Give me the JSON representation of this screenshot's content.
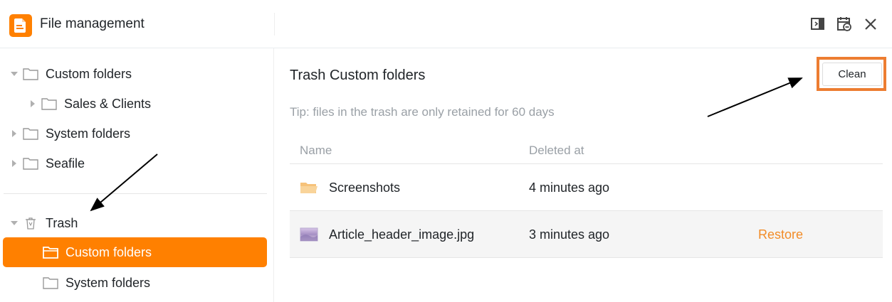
{
  "app": {
    "title": "File management"
  },
  "header_actions": [
    {
      "name": "panel-toggle-icon"
    },
    {
      "name": "calendar-settings-icon"
    },
    {
      "name": "close-icon"
    }
  ],
  "sidebar": {
    "items": [
      {
        "label": "Custom folders",
        "expanded": true,
        "level": 0
      },
      {
        "label": "Sales & Clients",
        "expanded": false,
        "level": 1
      },
      {
        "label": "System folders",
        "expanded": false,
        "level": 0
      },
      {
        "label": "Seafile",
        "expanded": false,
        "level": 0
      }
    ],
    "trash": {
      "label": "Trash",
      "expanded": true,
      "children": [
        {
          "label": "Custom folders",
          "active": true
        },
        {
          "label": "System folders",
          "active": false
        }
      ]
    }
  },
  "main": {
    "title": "Trash Custom folders",
    "clean_label": "Clean",
    "tip": "Tip: files in the trash are only retained for 60 days",
    "columns": {
      "name": "Name",
      "deleted_at": "Deleted at"
    },
    "rows": [
      {
        "name": "Screenshots",
        "deleted_at": "4 minutes ago",
        "icon": "folder-icon",
        "action": ""
      },
      {
        "name": "Article_header_image.jpg",
        "deleted_at": "3 minutes ago",
        "icon": "image-file-icon",
        "action": "Restore"
      }
    ]
  },
  "colors": {
    "accent": "#ff8000",
    "highlight_box": "#ed7d31",
    "restore_link": "#f28c28"
  }
}
